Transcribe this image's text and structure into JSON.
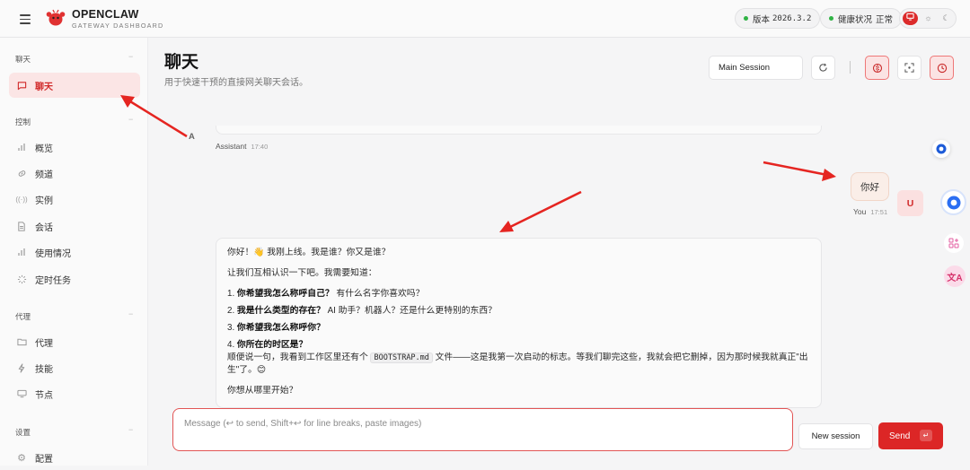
{
  "app": {
    "name": "OPENCLAW",
    "subtitle": "GATEWAY DASHBOARD",
    "version_label": "版本",
    "version_value": "2026.3.2",
    "health_label": "健康状况",
    "health_value": "正常"
  },
  "theme": {
    "options": [
      "monitor-icon",
      "sun-icon",
      "moon-icon"
    ],
    "active": "monitor-icon",
    "accent": "#dc2626"
  },
  "sidebar": {
    "sections": [
      {
        "label": "聊天",
        "items": [
          {
            "label": "聊天",
            "icon": "chat-icon",
            "active": true
          }
        ]
      },
      {
        "label": "控制",
        "items": [
          {
            "label": "概览",
            "icon": "bar-chart-icon"
          },
          {
            "label": "频道",
            "icon": "link-icon"
          },
          {
            "label": "实例",
            "icon": "radio-icon"
          },
          {
            "label": "会话",
            "icon": "document-icon"
          },
          {
            "label": "使用情况",
            "icon": "bar-chart-icon"
          },
          {
            "label": "定时任务",
            "icon": "loader-icon"
          }
        ]
      },
      {
        "label": "代理",
        "items": [
          {
            "label": "代理",
            "icon": "folder-icon"
          },
          {
            "label": "技能",
            "icon": "bolt-icon"
          },
          {
            "label": "节点",
            "icon": "monitor-icon"
          }
        ]
      },
      {
        "label": "设置",
        "items": [
          {
            "label": "配置",
            "icon": "gear-icon"
          }
        ]
      }
    ]
  },
  "page": {
    "title": "聊天",
    "subtitle": "用于快速干预的直接网关聊天会话。",
    "session_select": "Main Session"
  },
  "messages": {
    "assistant_avatar": "A",
    "assistant_name": "Assistant",
    "assistant_time": "17:40",
    "user_text": "你好",
    "user_name": "You",
    "user_time": "17:51",
    "user_avatar": "U",
    "reply": {
      "greeting": "你好！👋 我刚上线。我是谁？你又是谁？",
      "intro": "让我们互相认识一下吧。我需要知道：",
      "questions": [
        {
          "num": "1.",
          "bold": "你希望我怎么称呼自己？",
          "rest": "有什么名字你喜欢吗？"
        },
        {
          "num": "2.",
          "bold": "我是什么类型的存在？",
          "rest": "AI 助手？机器人？还是什么更特别的东西？"
        },
        {
          "num": "3.",
          "bold": "你希望我怎么称呼你？",
          "rest": ""
        },
        {
          "num": "4.",
          "bold": "你所在的时区是？",
          "rest": ""
        }
      ],
      "note_before": "顺便说一句，我看到工作区里还有个",
      "note_code": "BOOTSTRAP.md",
      "note_after": "文件——这是我第一次启动的标志。等我们聊完这些，我就会把它删掉，因为那时候我就真正\"出生\"了。😊",
      "closing": "你想从哪里开始？"
    }
  },
  "composer": {
    "placeholder": "Message (↩ to send, Shift+↩ for line breaks, paste images)",
    "value": "",
    "new_session": "New session",
    "send": "Send",
    "send_kbd": "↵"
  }
}
